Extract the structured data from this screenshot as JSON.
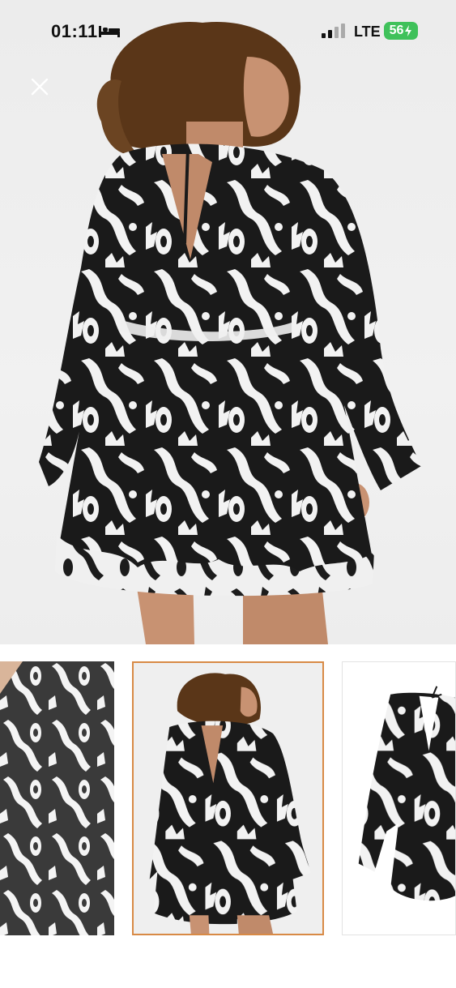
{
  "status_bar": {
    "time": "01:11",
    "network": "LTE",
    "battery": "56",
    "sleep_icon": "bed-icon",
    "signal_icon": "cellular-signal-icon",
    "charging_icon": "bolt-icon",
    "battery_color": "#3fc15a"
  },
  "viewer": {
    "close_icon": "close-icon",
    "selected_thumbnail_index": 1,
    "selected_border_color": "#d88a45",
    "thumbnails": [
      {
        "name": "thumbnail-fabric-closeup"
      },
      {
        "name": "thumbnail-back-view"
      },
      {
        "name": "thumbnail-product-flat"
      }
    ]
  }
}
